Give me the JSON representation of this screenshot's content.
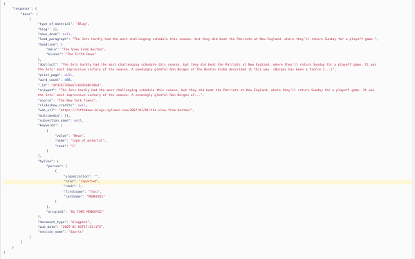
{
  "lines": [
    {
      "i": 0,
      "t": [
        [
          "p",
          "{"
        ]
      ]
    },
    {
      "i": 1,
      "t": [
        [
          "k",
          "\"response\""
        ],
        [
          "p",
          ": {"
        ]
      ]
    },
    {
      "i": 2,
      "t": [
        [
          "k",
          "\"docs\""
        ],
        [
          "p",
          ": ["
        ]
      ]
    },
    {
      "i": 3,
      "t": [
        [
          "p",
          "{"
        ]
      ]
    },
    {
      "i": 4,
      "t": [
        [
          "k",
          "\"type_of_material\""
        ],
        [
          "p",
          ": "
        ],
        [
          "s",
          "\"Blog\""
        ],
        [
          "p",
          ","
        ]
      ]
    },
    {
      "i": 4,
      "t": [
        [
          "k",
          "\"blog\""
        ],
        [
          "p",
          ": [],"
        ]
      ]
    },
    {
      "i": 4,
      "t": [
        [
          "k",
          "\"news_desk\""
        ],
        [
          "p",
          ": "
        ],
        [
          "l",
          "null"
        ],
        [
          "p",
          ","
        ]
      ]
    },
    {
      "i": 4,
      "t": [
        [
          "k",
          "\"lead_paragraph\""
        ],
        [
          "p",
          ": "
        ],
        [
          "s",
          "\"The Jets hardly had the most challenging schedule this season, but they did beat the Patriots at New England, where they'll return Sunday for a playoff game.\""
        ],
        [
          "p",
          ","
        ]
      ]
    },
    {
      "i": 4,
      "t": [
        [
          "k",
          "\"headline\""
        ],
        [
          "p",
          ": {"
        ]
      ]
    },
    {
      "i": 5,
      "t": [
        [
          "k",
          "\"main\""
        ],
        [
          "p",
          ": "
        ],
        [
          "s",
          "\"The View From Boston\""
        ],
        [
          "p",
          ","
        ]
      ]
    },
    {
      "i": 5,
      "t": [
        [
          "k",
          "\"kicker\""
        ],
        [
          "p",
          ": "
        ],
        [
          "s",
          "\"The Fifth Down\""
        ]
      ]
    },
    {
      "i": 4,
      "t": [
        [
          "p",
          "},"
        ]
      ]
    },
    {
      "i": 4,
      "t": [
        [
          "k",
          "\"abstract\""
        ],
        [
          "p",
          ": "
        ],
        [
          "s",
          "\"The Jets hardly had the most challenging schedule this season, but they did beat the Patriots at New England, where they'll return Sunday for a playoff game. It was"
        ]
      ]
    },
    {
      "i": 4,
      "t": [
        [
          "s",
          "the Jets' most impressive victory of the season. A seemingly gleeful Ron Borges of The Boston Globe described it this way. (Borges has been a fierce [...]\""
        ],
        [
          "p",
          ","
        ]
      ]
    },
    {
      "i": 4,
      "t": [
        [
          "k",
          "\"print_page\""
        ],
        [
          "p",
          ": "
        ],
        [
          "l",
          "null"
        ],
        [
          "p",
          ","
        ]
      ]
    },
    {
      "i": 4,
      "t": [
        [
          "k",
          "\"word_count\""
        ],
        [
          "p",
          ": "
        ],
        [
          "n",
          "488"
        ],
        [
          "p",
          ","
        ]
      ]
    },
    {
      "i": 4,
      "t": [
        [
          "k",
          "\"_id\""
        ],
        [
          "p",
          ": "
        ],
        [
          "s",
          "\"4fd267768eb7c8105d8b78bd\""
        ],
        [
          "p",
          ","
        ]
      ]
    },
    {
      "i": 4,
      "t": [
        [
          "k",
          "\"snippet\""
        ],
        [
          "p",
          ": "
        ],
        [
          "s",
          "\"The Jets hardly had the most challenging schedule this season, but they did beat the Patriots at New England, where they'll return Sunday for a playoff game. It was"
        ]
      ]
    },
    {
      "i": 4,
      "t": [
        [
          "s",
          "the Jets' most impressive victory of the season. A seemingly gleeful Ron Borges of...\""
        ],
        [
          "p",
          ","
        ]
      ]
    },
    {
      "i": 4,
      "t": [
        [
          "k",
          "\"source\""
        ],
        [
          "p",
          ": "
        ],
        [
          "s",
          "\"The New York Times\""
        ],
        [
          "p",
          ","
        ]
      ]
    },
    {
      "i": 4,
      "t": [
        [
          "k",
          "\"slideshow_credits\""
        ],
        [
          "p",
          ": "
        ],
        [
          "l",
          "null"
        ],
        [
          "p",
          ","
        ]
      ]
    },
    {
      "i": 4,
      "t": [
        [
          "k",
          "\"web_url\""
        ],
        [
          "p",
          ": "
        ],
        [
          "s",
          "\"https://fifthdown.blogs.nytimes.com/2007/01/01/the-view-from-boston/\""
        ],
        [
          "p",
          ","
        ]
      ]
    },
    {
      "i": 4,
      "t": [
        [
          "k",
          "\"multimedia\""
        ],
        [
          "p",
          ": [],"
        ]
      ]
    },
    {
      "i": 4,
      "t": [
        [
          "k",
          "\"subsection_name\""
        ],
        [
          "p",
          ": "
        ],
        [
          "l",
          "null"
        ],
        [
          "p",
          ","
        ]
      ]
    },
    {
      "i": 4,
      "t": [
        [
          "k",
          "\"keywords\""
        ],
        [
          "p",
          ": ["
        ]
      ]
    },
    {
      "i": 5,
      "t": [
        [
          "p",
          "{"
        ]
      ]
    },
    {
      "i": 6,
      "t": [
        [
          "k",
          "\"value\""
        ],
        [
          "p",
          ": "
        ],
        [
          "s",
          "\"News\""
        ],
        [
          "p",
          ","
        ]
      ]
    },
    {
      "i": 6,
      "t": [
        [
          "k",
          "\"name\""
        ],
        [
          "p",
          ": "
        ],
        [
          "s",
          "\"type_of_material\""
        ],
        [
          "p",
          ","
        ]
      ]
    },
    {
      "i": 6,
      "t": [
        [
          "k",
          "\"rank\""
        ],
        [
          "p",
          ": "
        ],
        [
          "s",
          "\"1\""
        ]
      ]
    },
    {
      "i": 5,
      "t": [
        [
          "p",
          "}"
        ]
      ]
    },
    {
      "i": 4,
      "t": [
        [
          "p",
          "],"
        ]
      ]
    },
    {
      "i": 4,
      "t": [
        [
          "k",
          "\"byline\""
        ],
        [
          "p",
          ": {"
        ]
      ]
    },
    {
      "i": 5,
      "t": [
        [
          "k",
          "\"person\""
        ],
        [
          "p",
          ": ["
        ]
      ]
    },
    {
      "i": 6,
      "t": [
        [
          "p",
          "{"
        ]
      ]
    },
    {
      "i": 7,
      "t": [
        [
          "k",
          "\"organization\""
        ],
        [
          "p",
          ": "
        ],
        [
          "s",
          "\"\""
        ],
        [
          "p",
          ","
        ]
      ]
    },
    {
      "i": 7,
      "t": [
        [
          "k",
          "\"role\""
        ],
        [
          "p",
          ": "
        ],
        [
          "s",
          "\"reported\""
        ],
        [
          "p",
          ","
        ]
      ],
      "hl": true
    },
    {
      "i": 7,
      "t": [
        [
          "k",
          "\"rank\""
        ],
        [
          "p",
          ": "
        ],
        [
          "n",
          "1"
        ],
        [
          "p",
          ","
        ]
      ]
    },
    {
      "i": 7,
      "t": [
        [
          "k",
          "\"firstname\""
        ],
        [
          "p",
          ": "
        ],
        [
          "s",
          "\"Toni\""
        ],
        [
          "p",
          ","
        ]
      ]
    },
    {
      "i": 7,
      "t": [
        [
          "k",
          "\"lastname\""
        ],
        [
          "p",
          ": "
        ],
        [
          "s",
          "\"MONKOVIC\""
        ]
      ]
    },
    {
      "i": 6,
      "t": [
        [
          "p",
          "}"
        ]
      ]
    },
    {
      "i": 5,
      "t": [
        [
          "p",
          "],"
        ]
      ]
    },
    {
      "i": 5,
      "t": [
        [
          "k",
          "\"original\""
        ],
        [
          "p",
          ": "
        ],
        [
          "s",
          "\"By TONI MONKOVIC\""
        ]
      ]
    },
    {
      "i": 4,
      "t": [
        [
          "p",
          "},"
        ]
      ]
    },
    {
      "i": 4,
      "t": [
        [
          "k",
          "\"document_type\""
        ],
        [
          "p",
          ": "
        ],
        [
          "s",
          "\"blogpost\""
        ],
        [
          "p",
          ","
        ]
      ]
    },
    {
      "i": 4,
      "t": [
        [
          "k",
          "\"pub_date\""
        ],
        [
          "p",
          ": "
        ],
        [
          "s",
          "\"2007-01-01T17:52:17Z\""
        ],
        [
          "p",
          ","
        ]
      ]
    },
    {
      "i": 4,
      "t": [
        [
          "k",
          "\"section_name\""
        ],
        [
          "p",
          ": "
        ],
        [
          "s",
          "\"Sports\""
        ]
      ]
    },
    {
      "i": 3,
      "t": [
        [
          "p",
          "}"
        ]
      ]
    },
    {
      "i": 2,
      "t": [
        [
          "p",
          "]"
        ]
      ]
    },
    {
      "i": 1,
      "t": [
        [
          "p",
          "}"
        ]
      ]
    },
    {
      "i": 0,
      "t": [
        [
          "p",
          "}"
        ]
      ]
    }
  ]
}
